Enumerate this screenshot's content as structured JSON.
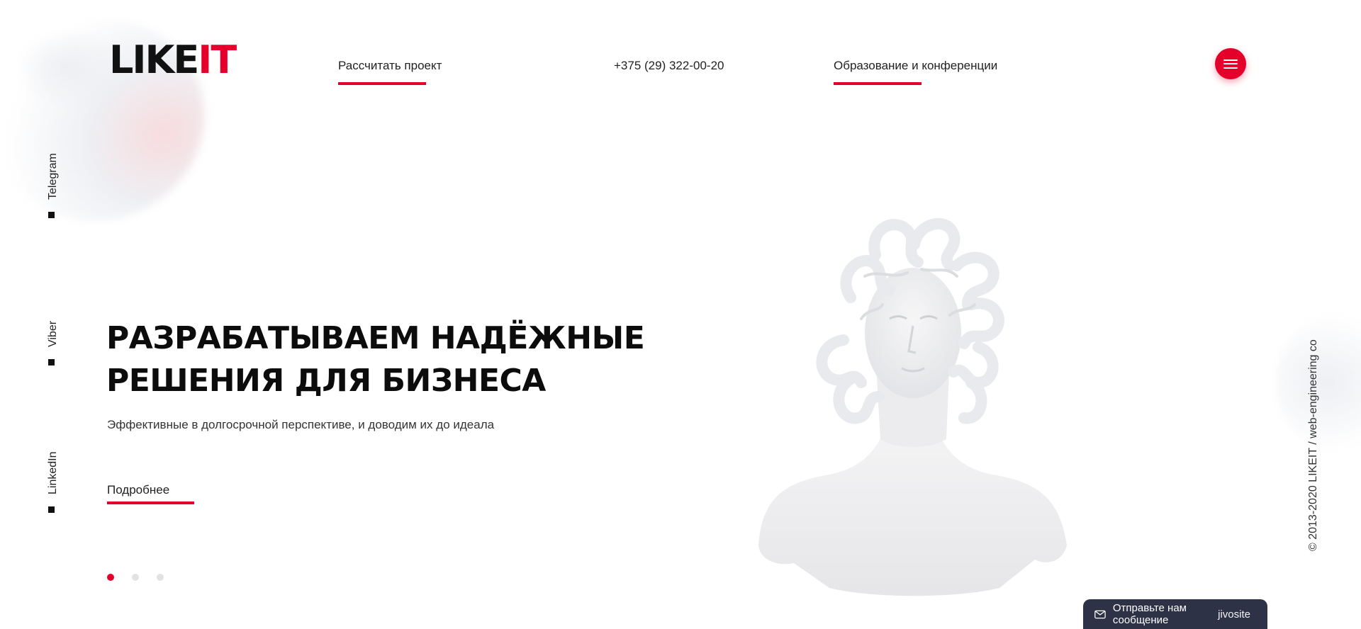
{
  "logo": {
    "part1": "LIKE",
    "part2": "IT"
  },
  "nav": {
    "calc_label": "Рассчитать проект",
    "phone": "+375 (29) 322-00-20",
    "edu_label": "Образование и конференции",
    "menu_icon": "hamburger-icon"
  },
  "social": [
    {
      "label": "Telegram"
    },
    {
      "label": "Viber"
    },
    {
      "label": "LinkedIn"
    }
  ],
  "hero": {
    "title_line1": "РАЗРАБАТЫВАЕМ НАДЁЖНЫЕ",
    "title_line2": "РЕШЕНИЯ ДЛЯ БИЗНЕСА",
    "subtitle": "Эффективные в долгосрочной перспективе, и доводим их до идеала",
    "more_label": "Подробнее"
  },
  "slider": {
    "count": 3,
    "active": 1
  },
  "copyright": "© 2013-2020 LIKEIT / web-engineering co",
  "chat": {
    "label": "Отправьте нам сообщение",
    "brand": "jivosite"
  },
  "colors": {
    "accent": "#e5002b",
    "text": "#111111",
    "chat_bg": "#2d3247"
  }
}
